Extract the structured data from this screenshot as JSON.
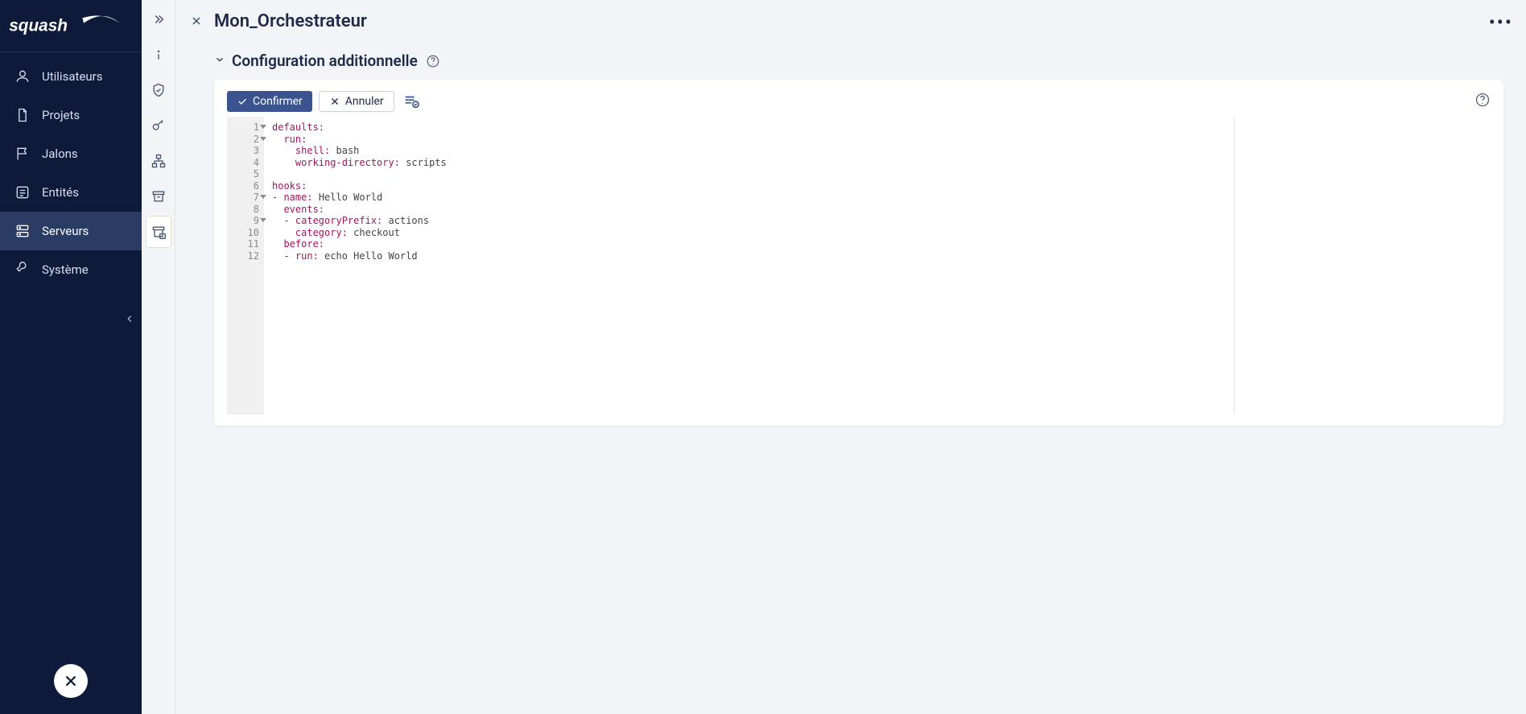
{
  "brand": "squash",
  "page": {
    "title": "Mon_Orchestrateur"
  },
  "sidebar": {
    "items": [
      {
        "label": "Utilisateurs"
      },
      {
        "label": "Projets"
      },
      {
        "label": "Jalons"
      },
      {
        "label": "Entités"
      },
      {
        "label": "Serveurs"
      },
      {
        "label": "Système"
      }
    ],
    "activeIndex": 4
  },
  "iconbar": {
    "items": [
      {
        "name": "info-icon"
      },
      {
        "name": "shield-icon"
      },
      {
        "name": "key-icon"
      },
      {
        "name": "hierarchy-icon"
      },
      {
        "name": "archive-icon"
      },
      {
        "name": "server-archive-icon"
      }
    ],
    "activeIndex": 5
  },
  "section": {
    "title": "Configuration additionnelle"
  },
  "buttons": {
    "confirm": "Confirmer",
    "cancel": "Annuler"
  },
  "editor": {
    "language": "yaml",
    "lineCount": 12,
    "foldableLines": [
      1,
      2,
      7,
      9
    ],
    "lines": [
      {
        "key": "defaults",
        "value": "",
        "indent": 0
      },
      {
        "key": "run",
        "value": "",
        "indent": 1
      },
      {
        "key": "shell",
        "value": "bash",
        "indent": 2
      },
      {
        "key": "working-directory",
        "value": "scripts",
        "indent": 2
      },
      {
        "blank": true
      },
      {
        "key": "hooks",
        "value": "",
        "indent": 0
      },
      {
        "dash": true,
        "key": "name",
        "value": "Hello World",
        "indent": 0
      },
      {
        "key": "events",
        "value": "",
        "indent": 1
      },
      {
        "dash": true,
        "key": "categoryPrefix",
        "value": "actions",
        "indent": 1
      },
      {
        "key": "category",
        "value": "checkout",
        "indent": 2
      },
      {
        "key": "before",
        "value": "",
        "indent": 1
      },
      {
        "dash": true,
        "key": "run",
        "value": "echo Hello World",
        "indent": 1
      }
    ],
    "rawText": "defaults:\n  run:\n    shell: bash\n    working-directory: scripts\n\nhooks:\n- name: Hello World\n  events:\n  - categoryPrefix: actions\n    category: checkout\n  before:\n  - run: echo Hello World"
  }
}
